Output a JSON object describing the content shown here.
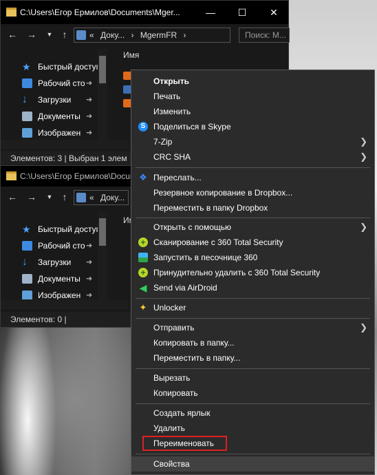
{
  "window1": {
    "title": "C:\\Users\\Егор Ермилов\\Documents\\Mger...",
    "breadcrumb": [
      "«",
      "Доку...",
      "›",
      "MgermFR",
      "›"
    ],
    "search_placeholder": "Поиск: M...",
    "column_header": "Имя",
    "status": "Элементов: 3   |   Выбран 1 элем"
  },
  "window2": {
    "title": "C:\\Users\\Егор Ермилов\\Docum",
    "breadcrumb": [
      "«",
      "Доку..."
    ],
    "column_header": "Им",
    "status": "Элементов: 0   |"
  },
  "sidebar": [
    {
      "label": "Быстрый доступ",
      "icon": "star-icon",
      "pinned": false
    },
    {
      "label": "Рабочий сто",
      "icon": "desktop-icon",
      "pinned": true
    },
    {
      "label": "Загрузки",
      "icon": "download-icon",
      "pinned": true
    },
    {
      "label": "Документы",
      "icon": "documents-icon",
      "pinned": true
    },
    {
      "label": "Изображен",
      "icon": "pictures-icon",
      "pinned": true
    }
  ],
  "context_menu": {
    "groups": [
      [
        {
          "label": "Открыть",
          "bold": true
        },
        {
          "label": "Печать"
        },
        {
          "label": "Изменить"
        },
        {
          "label": "Поделиться в Skype",
          "icon": "skype-icon"
        },
        {
          "label": "7-Zip",
          "submenu": true
        },
        {
          "label": "CRC SHA",
          "submenu": true
        }
      ],
      [
        {
          "label": "Переслать...",
          "icon": "dropbox-icon"
        },
        {
          "label": "Резервное копирование в Dropbox..."
        },
        {
          "label": "Переместить в папку Dropbox"
        }
      ],
      [
        {
          "label": "Открыть с помощью",
          "submenu": true
        },
        {
          "label": "Сканирование с 360 Total Security",
          "icon": "360-scan-icon"
        },
        {
          "label": "Запустить в песочнице 360",
          "icon": "sandbox-icon"
        },
        {
          "label": "Принудительно удалить с  360 Total Security",
          "icon": "360-delete-icon"
        },
        {
          "label": "Send via AirDroid",
          "icon": "airdroid-icon"
        }
      ],
      [
        {
          "label": "Unlocker",
          "icon": "unlocker-icon"
        }
      ],
      [
        {
          "label": "Отправить",
          "submenu": true
        },
        {
          "label": "Копировать в папку..."
        },
        {
          "label": "Переместить в папку..."
        }
      ],
      [
        {
          "label": "Вырезать"
        },
        {
          "label": "Копировать"
        }
      ],
      [
        {
          "label": "Создать ярлык"
        },
        {
          "label": "Удалить"
        },
        {
          "label": "Переименовать",
          "highlighted_box": true
        }
      ],
      [
        {
          "label": "Свойства",
          "hover": true
        }
      ]
    ]
  },
  "colors": {
    "menu_bg": "#2b2b2b",
    "highlight_box": "#e02020",
    "window_bg": "#191919"
  }
}
